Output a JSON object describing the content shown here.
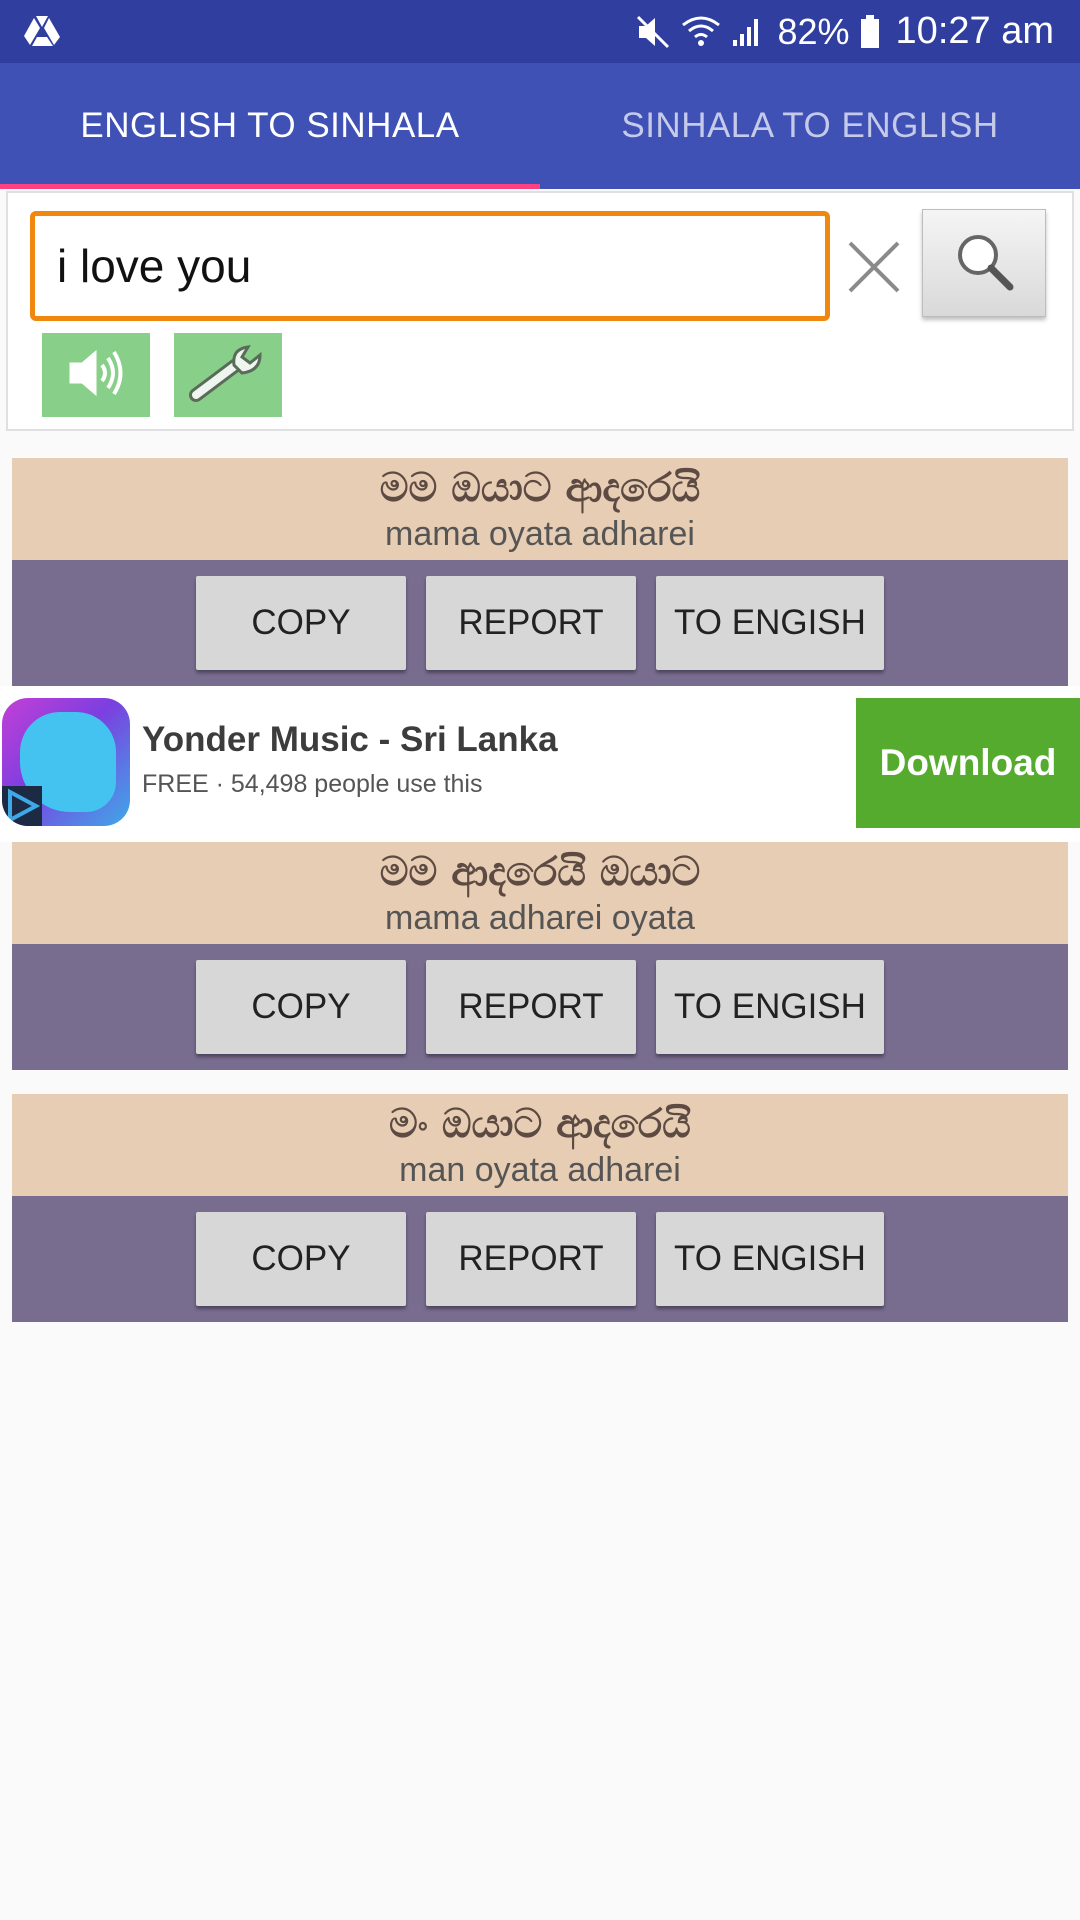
{
  "status_bar": {
    "battery": "82%",
    "time": "10:27 am"
  },
  "tabs": [
    {
      "label": "ENGLISH TO SINHALA",
      "active": true
    },
    {
      "label": "SINHALA TO ENGLISH",
      "active": false
    }
  ],
  "search": {
    "value": "i love you",
    "placeholder": ""
  },
  "results": [
    {
      "sinhala": "මම ඔයාට ආදරෙයි",
      "roman": "mama oyata adharei",
      "copy": "COPY",
      "report": "REPORT",
      "to_english": "TO ENGISH"
    },
    {
      "sinhala": "මම ආදරෙයි ඔයාට",
      "roman": "mama adharei oyata",
      "copy": "COPY",
      "report": "REPORT",
      "to_english": "TO ENGISH"
    },
    {
      "sinhala": "මං ඔයාට ආදරෙයි",
      "roman": "man oyata adharei",
      "copy": "COPY",
      "report": "REPORT",
      "to_english": "TO ENGISH"
    }
  ],
  "ad": {
    "title": "Yonder Music - Sri Lanka",
    "subtitle": "FREE · 54,498 people use this",
    "button": "Download"
  },
  "colors": {
    "status_bar": "#303f9f",
    "tab_bar": "#3f51b5",
    "tab_indicator": "#ff4081",
    "input_border": "#f0880f",
    "card_top": "#e6cdb3",
    "card_bottom": "#786c8f",
    "tool_button": "#88cf8a",
    "ad_button": "#55ab2e"
  },
  "icons": [
    "drive-icon",
    "mute-icon",
    "wifi-icon",
    "signal-icon",
    "battery-icon",
    "clear-icon",
    "search-icon",
    "speaker-icon",
    "wrench-icon",
    "adchoices-icon"
  ]
}
